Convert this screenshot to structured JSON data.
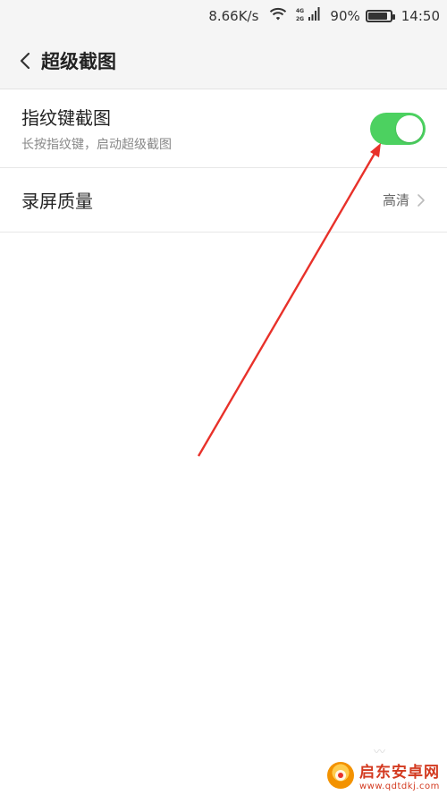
{
  "status_bar": {
    "net_speed": "8.66K/s",
    "network_types": [
      "4G",
      "2G"
    ],
    "battery_percent": "90%",
    "battery_level": 0.9,
    "time": "14:50",
    "icons": [
      "wifi-icon",
      "signal-icon",
      "battery-icon"
    ]
  },
  "header": {
    "back_icon": "chevron-left-icon",
    "title": "超级截图"
  },
  "settings": {
    "fingerprint": {
      "title": "指纹键截图",
      "subtitle": "长按指纹键，启动超级截图",
      "toggle_on": true
    },
    "quality": {
      "title": "录屏质量",
      "value": "高清",
      "icon": "chevron-right-icon"
    }
  },
  "colors": {
    "toggle_on": "#4cd160",
    "arrow": "#e8312a",
    "header_bg": "#f5f5f5",
    "watermark": "#d33a20"
  },
  "watermark": {
    "title": "启东安卓网",
    "url": "www.qdtdkj.com"
  },
  "faint_glyph": "〰"
}
